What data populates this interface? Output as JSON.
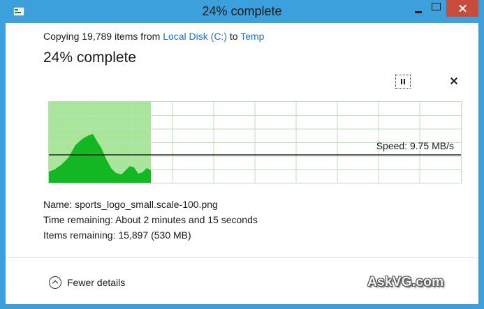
{
  "window": {
    "title": "24% complete",
    "icons": {
      "app": "file-copy-icon",
      "minimize": "minimize-icon",
      "maximize": "maximize-icon",
      "close": "close-icon"
    }
  },
  "header": {
    "copy_prefix": "Copying 19,789 items from ",
    "source": "Local Disk (C:)",
    "connector": " to ",
    "destination": "Temp",
    "progress_text": "24% complete"
  },
  "controls": {
    "pause_icon": "pause-icon",
    "cancel_icon": "close-icon"
  },
  "graph": {
    "progress_fraction": 0.24,
    "speed_text": "Speed: 9.75 MB/s",
    "colors": {
      "completed_fill": "#a9e59a",
      "speed_fill": "#13b623",
      "grid": "#b8e3b8",
      "speed_line": "#000000"
    }
  },
  "details": {
    "name_text": "Name:  sports_logo_small.scale-100.png",
    "time_text": "Time remaining:  About 2 minutes and 15 seconds",
    "items_text": "Items remaining:  15,897 (530 MB)"
  },
  "footer": {
    "fewer_details_label": "Fewer details",
    "chevron_icon": "chevron-up-icon",
    "watermark": "AskVG.com"
  },
  "colors": {
    "titlebar": "#3ba0dc",
    "close_button": "#c74c3c",
    "link": "#1e6fc0"
  }
}
